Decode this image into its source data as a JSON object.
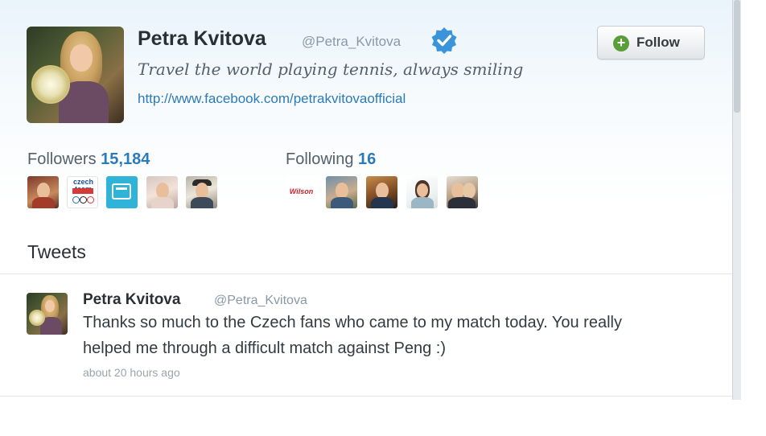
{
  "profile": {
    "name": "Petra Kvitova",
    "handle": "@Petra_Kvitova",
    "verified": true,
    "bio": "Travel the world playing tennis, always smiling",
    "url": "http://www.facebook.com/petrakvitovaofficial",
    "avatar_icon": "profile-photo-avatar"
  },
  "follow_button": {
    "label": "Follow",
    "icon": "plus-circle-icon",
    "icon_color": "#5a9e3a"
  },
  "followers": {
    "label": "Followers",
    "count": "15,184",
    "thumbnails": [
      {
        "name": "follower-thumb-1",
        "icon": "person-photo"
      },
      {
        "name": "follower-thumb-2",
        "icon": "czech-team-logo",
        "text": "czech team"
      },
      {
        "name": "follower-thumb-3",
        "icon": "olympic-2012-logo"
      },
      {
        "name": "follower-thumb-4",
        "icon": "person-photo"
      },
      {
        "name": "follower-thumb-5",
        "icon": "person-photo"
      }
    ]
  },
  "following": {
    "label": "Following",
    "count": "16",
    "thumbnails": [
      {
        "name": "following-thumb-1",
        "icon": "wilson-logo",
        "text": "Wilson"
      },
      {
        "name": "following-thumb-2",
        "icon": "person-photo"
      },
      {
        "name": "following-thumb-3",
        "icon": "person-photo"
      },
      {
        "name": "following-thumb-4",
        "icon": "person-photo"
      },
      {
        "name": "following-thumb-5",
        "icon": "person-photo"
      }
    ]
  },
  "tweets_section": {
    "heading": "Tweets"
  },
  "tweet": {
    "author_name": "Petra Kvitova",
    "author_handle": "@Petra_Kvitova",
    "text_line_1": "Thanks so much to the Czech fans who came to my match today. You really",
    "text_line_2": "helped me through a difficult match against Peng :)",
    "timestamp": "about 20 hours ago"
  },
  "colors": {
    "link": "#2b7bb9",
    "verified_badge": "#3b94d9",
    "header_gradient_top": "#eaf4fb",
    "muted_text": "#8899a6"
  }
}
